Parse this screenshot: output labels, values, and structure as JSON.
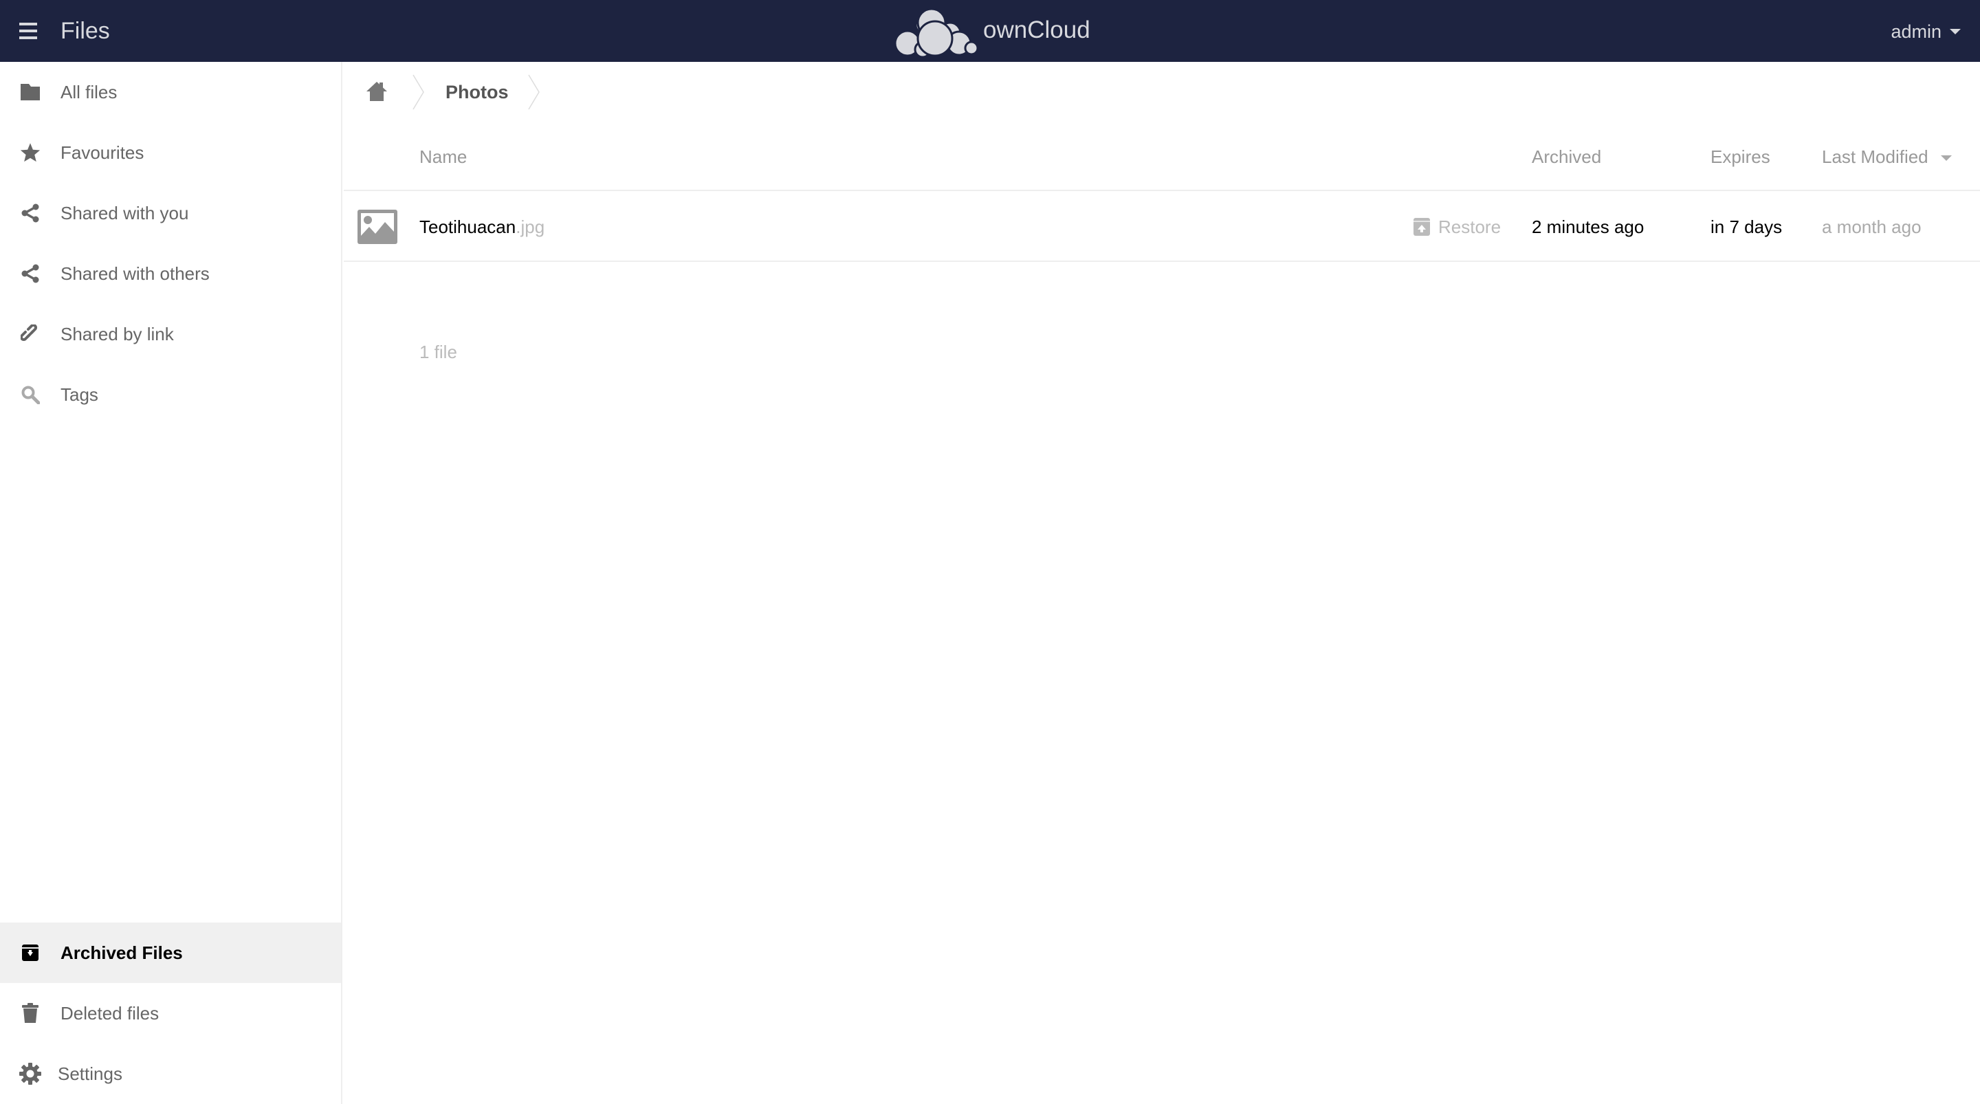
{
  "header": {
    "app_title": "Files",
    "brand": "ownCloud",
    "user": "admin",
    "background_color": "#1d2340"
  },
  "sidebar": {
    "items": [
      {
        "label": "All files",
        "icon": "folder-icon"
      },
      {
        "label": "Favourites",
        "icon": "star-icon"
      },
      {
        "label": "Shared with you",
        "icon": "share-icon"
      },
      {
        "label": "Shared with others",
        "icon": "share-icon"
      },
      {
        "label": "Shared by link",
        "icon": "link-icon"
      },
      {
        "label": "Tags",
        "icon": "search-icon"
      }
    ],
    "bottom_items": [
      {
        "label": "Archived Files",
        "icon": "archive-icon",
        "active": true
      },
      {
        "label": "Deleted files",
        "icon": "trash-icon"
      },
      {
        "label": "Settings",
        "icon": "gear-icon"
      }
    ]
  },
  "breadcrumb": {
    "home_icon": "home-icon",
    "items": [
      "Photos"
    ]
  },
  "table": {
    "columns": {
      "name": "Name",
      "archived": "Archived",
      "expires": "Expires",
      "last_modified": "Last Modified"
    },
    "sort_column": "Last Modified",
    "rows": [
      {
        "name": "Teotihuacan",
        "extension": ".jpg",
        "action": "Restore",
        "archived": "2 minutes ago",
        "expires": "in 7 days",
        "last_modified": "a month ago"
      }
    ],
    "summary": "1 file"
  }
}
